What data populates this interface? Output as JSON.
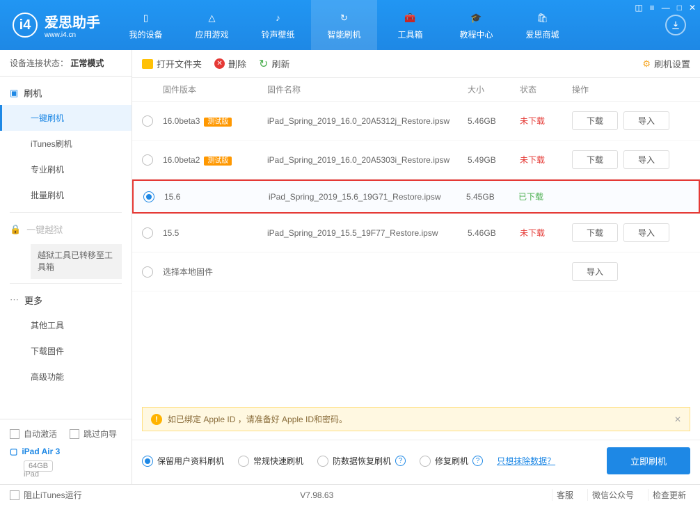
{
  "app": {
    "name": "爱思助手",
    "domain": "www.i4.cn"
  },
  "window_controls": [
    "◫",
    "≡",
    "—",
    "□",
    "✕"
  ],
  "nav": [
    {
      "label": "我的设备"
    },
    {
      "label": "应用游戏"
    },
    {
      "label": "铃声壁纸"
    },
    {
      "label": "智能刷机",
      "active": true
    },
    {
      "label": "工具箱"
    },
    {
      "label": "教程中心"
    },
    {
      "label": "爱思商城"
    }
  ],
  "sidebar": {
    "status_label": "设备连接状态：",
    "status_value": "正常模式",
    "flash_label": "刷机",
    "items": [
      "一键刷机",
      "iTunes刷机",
      "专业刷机",
      "批量刷机"
    ],
    "active_index": 0,
    "jailbreak_label": "一键越狱",
    "jailbreak_notice": "越狱工具已转移至工具箱",
    "more_label": "更多",
    "more_items": [
      "其他工具",
      "下载固件",
      "高级功能"
    ],
    "auto_activate": "自动激活",
    "skip_guide": "跳过向导",
    "device_name": "iPad Air 3",
    "device_storage": "64GB",
    "device_type": "iPad"
  },
  "toolbar": {
    "open_folder": "打开文件夹",
    "delete": "删除",
    "refresh": "刷新",
    "settings": "刷机设置"
  },
  "columns": {
    "version": "固件版本",
    "name": "固件名称",
    "size": "大小",
    "status": "状态",
    "ops": "操作"
  },
  "firmware": [
    {
      "version": "16.0beta3",
      "beta": "测试版",
      "name": "iPad_Spring_2019_16.0_20A5312j_Restore.ipsw",
      "size": "5.46GB",
      "status": "未下载",
      "status_class": "status-red",
      "selected": false,
      "show_ops": true
    },
    {
      "version": "16.0beta2",
      "beta": "测试版",
      "name": "iPad_Spring_2019_16.0_20A5303i_Restore.ipsw",
      "size": "5.49GB",
      "status": "未下载",
      "status_class": "status-red",
      "selected": false,
      "show_ops": true
    },
    {
      "version": "15.6",
      "beta": "",
      "name": "iPad_Spring_2019_15.6_19G71_Restore.ipsw",
      "size": "5.45GB",
      "status": "已下载",
      "status_class": "status-green",
      "selected": true,
      "show_ops": false
    },
    {
      "version": "15.5",
      "beta": "",
      "name": "iPad_Spring_2019_15.5_19F77_Restore.ipsw",
      "size": "5.46GB",
      "status": "未下载",
      "status_class": "status-red",
      "selected": false,
      "show_ops": true
    }
  ],
  "local_fw": "选择本地固件",
  "ops": {
    "download": "下载",
    "import": "导入"
  },
  "warning": "如已绑定 Apple ID ，请准备好 Apple ID和密码。",
  "options": {
    "keep_data": "保留用户资料刷机",
    "normal": "常规快速刷机",
    "prevent": "防数据恢复刷机",
    "repair": "修复刷机",
    "erase_link": "只想抹除数据？",
    "selected": 0
  },
  "primary": "立即刷机",
  "footer": {
    "block_itunes": "阻止iTunes运行",
    "version": "V7.98.63",
    "links": [
      "客服",
      "微信公众号",
      "检查更新"
    ]
  }
}
